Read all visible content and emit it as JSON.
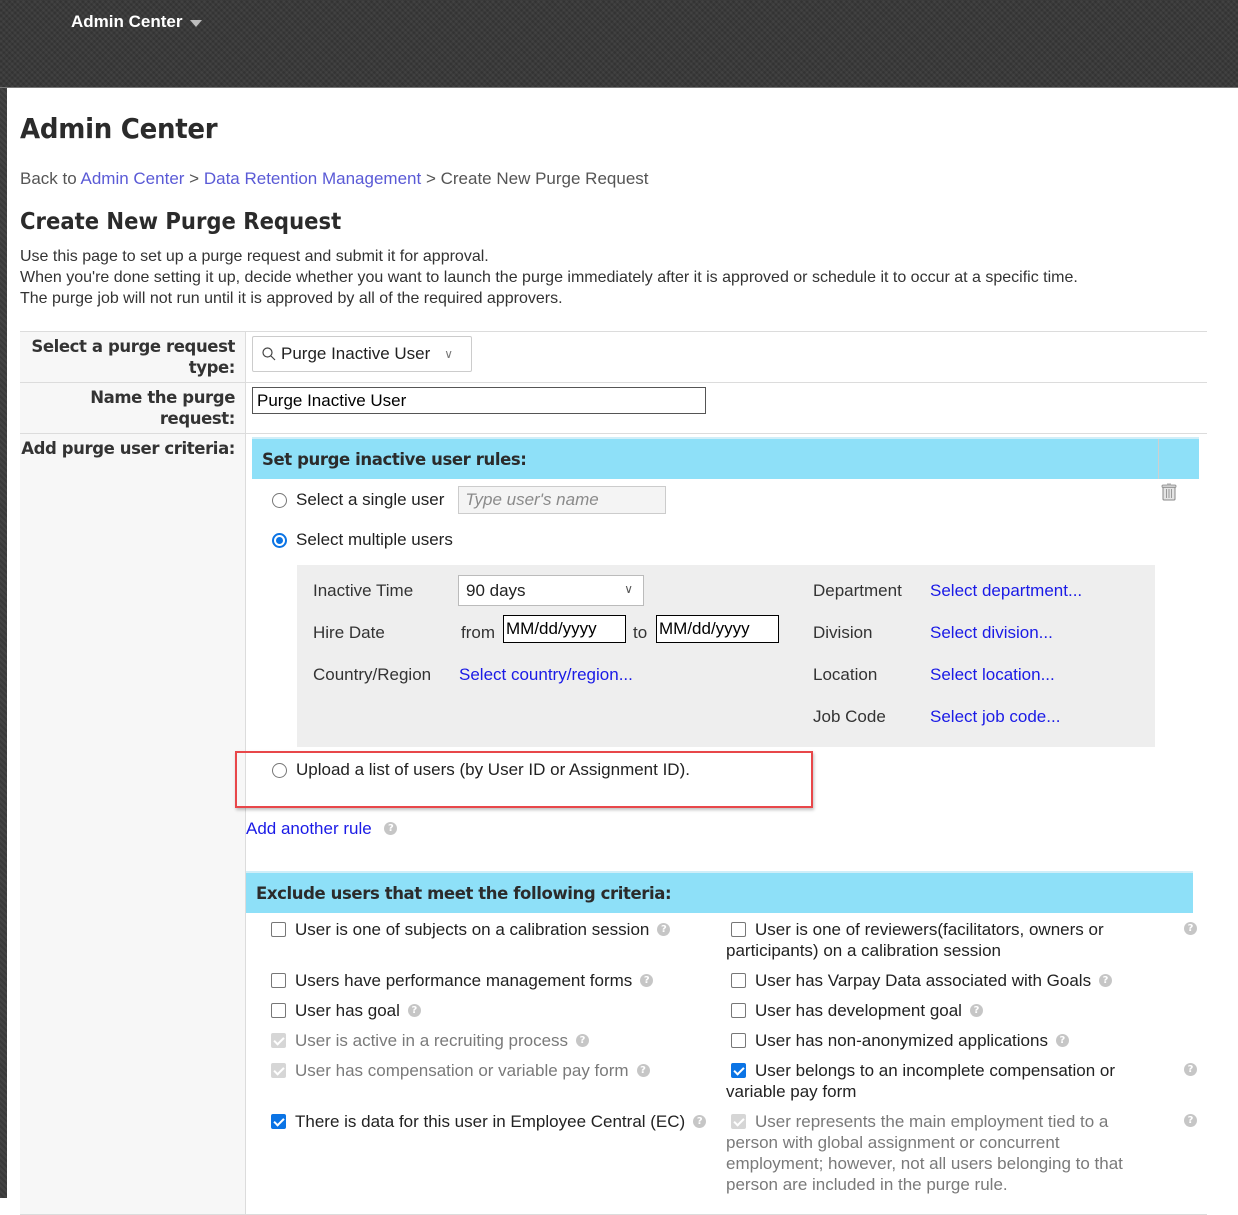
{
  "topbar": {
    "title": "Admin Center"
  },
  "page": {
    "title": "Admin Center",
    "breadcrumb": {
      "prefix": "Back to",
      "items": [
        "Admin Center",
        "Data Retention Management"
      ],
      "separator": ">",
      "current": "Create New Purge Request"
    },
    "section_title": "Create New Purge Request",
    "intro": [
      "Use this page to set up a purge request and submit it for approval.",
      "When you're done setting it up, decide whether you want to launch the purge immediately after it is approved or schedule it to occur at a specific time.",
      "The purge job will not run until it is approved by all of the required approvers."
    ]
  },
  "form": {
    "type_label": "Select a purge request type:",
    "type_value": "Purge Inactive User",
    "name_label": "Name the purge request:",
    "name_value": "Purge Inactive User",
    "criteria_label": "Add purge user criteria:",
    "rules": {
      "header": "Set purge inactive user rules:",
      "single_user_label": "Select a single user",
      "single_user_placeholder": "Type user's name",
      "multiple_users_label": "Select multiple users",
      "selected_option": "multiple",
      "filters": {
        "inactive_time_label": "Inactive Time",
        "inactive_time_value": "90 days",
        "hire_date_label": "Hire Date",
        "from_label": "from",
        "to_label": "to",
        "date_placeholder": "MM/dd/yyyy",
        "from_value": "MM/dd/yyyy",
        "to_value": "MM/dd/yyyy",
        "country_label": "Country/Region",
        "country_link": "Select country/region...",
        "department_label": "Department",
        "department_link": "Select department...",
        "division_label": "Division",
        "division_link": "Select division...",
        "location_label": "Location",
        "location_link": "Select location...",
        "job_code_label": "Job Code",
        "job_code_link": "Select job code..."
      },
      "upload_label": "Upload a list of users (by User ID or Assignment ID).",
      "add_rule_link": "Add another rule"
    },
    "exclude": {
      "header": "Exclude users that meet the following criteria:",
      "left": [
        {
          "label": "User is one of subjects on a calibration session",
          "state": "unchecked"
        },
        {
          "label": "Users have performance management forms",
          "state": "unchecked"
        },
        {
          "label": "User has goal",
          "state": "unchecked"
        },
        {
          "label": "User is active in a recruiting process",
          "state": "disabled-checked"
        },
        {
          "label": "User has compensation or variable pay form",
          "state": "disabled-checked"
        },
        {
          "label": "There is data for this user in Employee Central (EC)",
          "state": "checked"
        }
      ],
      "right": [
        {
          "label": "User is one of reviewers(facilitators, owners or participants) on a calibration session",
          "state": "unchecked"
        },
        {
          "label": "User has Varpay Data associated with Goals",
          "state": "unchecked"
        },
        {
          "label": "User has development goal",
          "state": "unchecked"
        },
        {
          "label": "User has non-anonymized applications",
          "state": "unchecked"
        },
        {
          "label": "User belongs to an incomplete compensation or variable pay form",
          "state": "checked"
        },
        {
          "label": "User represents the main employment tied to a person with global assignment or concurrent employment; however, not all users belonging to that person are included in the purge rule.",
          "state": "disabled-checked"
        }
      ]
    }
  },
  "icons": {
    "help_glyph": "?",
    "chevron_glyph": "∨"
  },
  "colors": {
    "section_header_bg": "#8ee0f8",
    "link": "#1a1ae6",
    "breadcrumb_link": "#5a5ad6",
    "checkbox_checked": "#0b74e5",
    "highlight_border": "#e8474a"
  }
}
